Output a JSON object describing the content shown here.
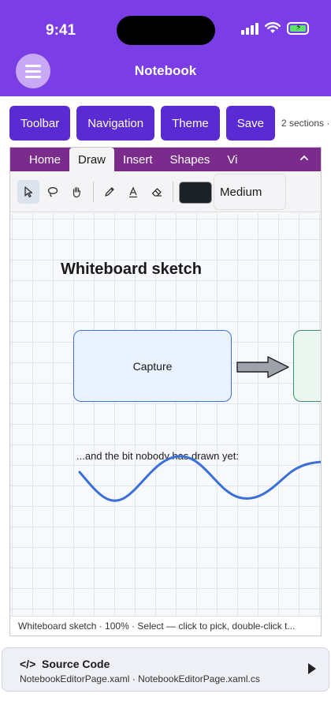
{
  "status_bar": {
    "time": "9:41"
  },
  "header": {
    "title": "Notebook",
    "menu_icon": "hamburger-icon"
  },
  "demo_buttons": [
    {
      "label": "Toolbar"
    },
    {
      "label": "Navigation"
    },
    {
      "label": "Theme"
    },
    {
      "label": "Save"
    }
  ],
  "demo_note": "2 sections ·",
  "ribbon": {
    "tabs": [
      "Home",
      "Draw",
      "Insert",
      "Shapes",
      "Vi"
    ],
    "active_tab": "Draw",
    "collapse_icon": "chevron-up-icon"
  },
  "draw_tools": {
    "items": [
      "select-arrow-icon",
      "lasso-icon",
      "hand-pan-icon",
      "pen-icon",
      "text-icon",
      "eraser-icon"
    ],
    "active": "select-arrow-icon",
    "pen_color": "#1c2128",
    "thickness": "Medium"
  },
  "canvas": {
    "title": "Whiteboard sketch",
    "box_label": "Capture",
    "caption": "...and the bit nobody has drawn yet:",
    "box_stroke": "#3b74d9",
    "box_fill": "#eaf1ff",
    "next_box_stroke": "#3a8f66",
    "stroke_color": "#3b6fd8"
  },
  "editor_status": "Whiteboard sketch · 100% · Select — click to pick, double-click t...",
  "source_code": {
    "title": "Source Code",
    "icon": "code-brackets-icon",
    "files": "NotebookEditorPage.xaml · NotebookEditorPage.xaml.cs",
    "expand_icon": "play-triangle-icon"
  },
  "colors": {
    "header": "#7a3de6",
    "button": "#5a2bd2",
    "ribbon": "#7a2b8c"
  }
}
